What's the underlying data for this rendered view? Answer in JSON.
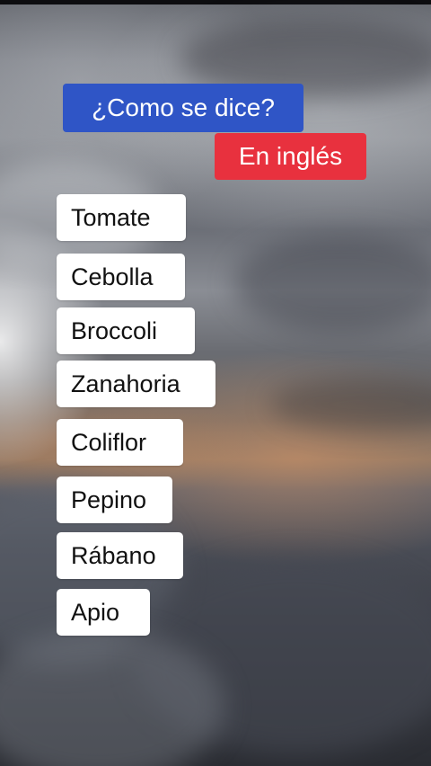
{
  "header": {
    "title": "¿Como se dice?",
    "subtitle": "En inglés"
  },
  "words": [
    "Tomate",
    "Cebolla",
    "Broccoli",
    "Zanahoria",
    "Coliflor",
    "Pepino",
    "Rábano",
    "Apio"
  ],
  "colors": {
    "title_badge": "#2f55c6",
    "subtitle_badge": "#e8313e",
    "card": "#ffffff",
    "card_text": "#111111"
  }
}
